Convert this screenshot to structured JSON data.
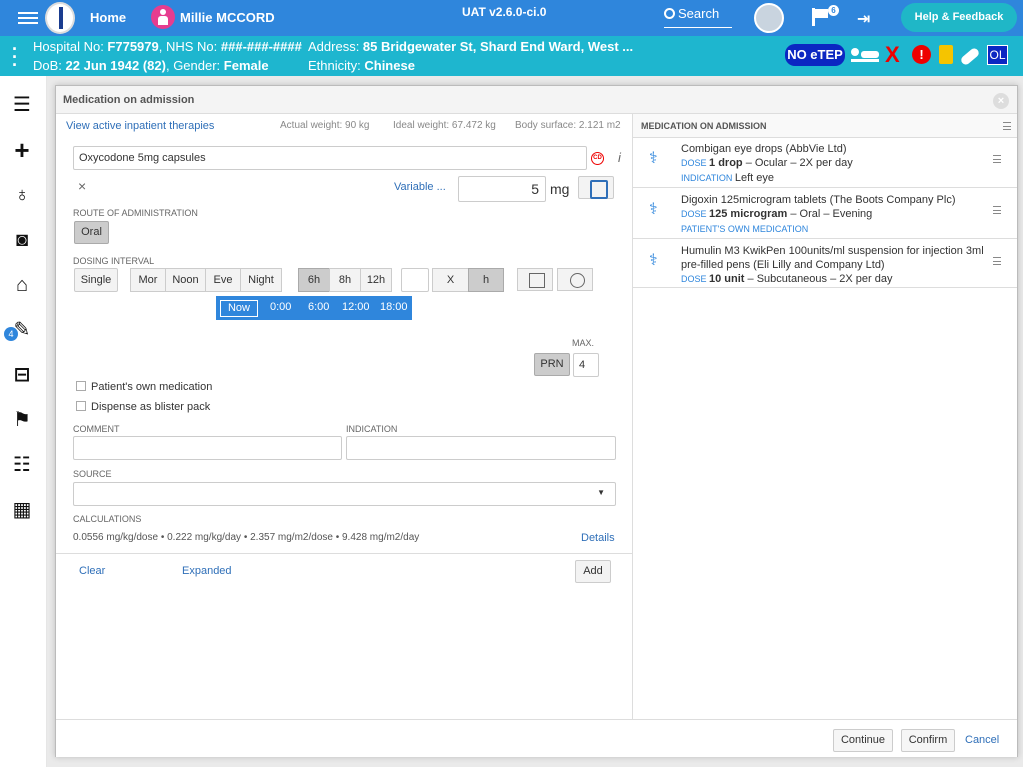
{
  "header": {
    "home_label": "Home",
    "patient_name": "Millie MCCORD",
    "version": "UAT v2.6.0-ci.0",
    "search_label": "Search",
    "flag_count": "6",
    "help_label": "Help & Feedback"
  },
  "patient_bar": {
    "hospital_no_label": "Hospital No: ",
    "hospital_no": "F775979",
    "nhs_label": ", NHS No: ",
    "nhs_no": "###-###-####",
    "dob_label": "DoB: ",
    "dob": "22 Jun 1942 (82)",
    "gender_label": ", Gender: ",
    "gender": "Female",
    "address_label": "Address: ",
    "address": "85 Bridgewater St, Shard End Ward, West ...",
    "ethnicity_label": "Ethnicity: ",
    "ethnicity": "Chinese",
    "no_etep": "NO eTEP",
    "ol": "OL",
    "alert": "!"
  },
  "sidebar": {
    "badge": "4",
    "icons": [
      "list-icon",
      "plus-icon",
      "stethoscope-icon",
      "camera-icon",
      "home-plus-icon",
      "prescription-edit-icon",
      "inbox-icon",
      "walking-icon",
      "checklist-icon",
      "monitor-icon"
    ]
  },
  "modal": {
    "title": "Medication on admission",
    "view_active_link": "View active inpatient therapies",
    "actual_weight": "Actual weight: 90 kg",
    "ideal_weight": "Ideal weight: 67.472 kg",
    "body_surface": "Body surface: 2.121 m2",
    "drug_value": "Oxycodone 5mg capsules",
    "cd_badge": "CD",
    "variable_link": "Variable ...",
    "dose_value": "5",
    "dose_unit": "mg",
    "route_label": "ROUTE OF ADMINISTRATION",
    "route_option": "Oral",
    "dosing_label": "DOSING INTERVAL",
    "dosing_single": "Single",
    "dosing_times": [
      "Mor",
      "Noon",
      "Eve",
      "Night"
    ],
    "dosing_hours": [
      "6h",
      "8h",
      "12h"
    ],
    "x_label": "X",
    "h_label": "h",
    "timeline_now": "Now",
    "timeline_times": [
      "0:00",
      "6:00",
      "12:00",
      "18:00"
    ],
    "max_label": "MAX.",
    "prn_label": "PRN",
    "max_value": "4",
    "own_med_label": "Patient's own medication",
    "blister_label": "Dispense as blister pack",
    "comment_label": "COMMENT",
    "indication_label": "INDICATION",
    "source_label": "SOURCE",
    "calc_label": "CALCULATIONS",
    "calc_text": "0.0556 mg/kg/dose • 0.222 mg/kg/day • 2.357 mg/m2/dose • 9.428 mg/m2/day",
    "details_link": "Details",
    "clear_link": "Clear",
    "expanded_link": "Expanded",
    "add_button": "Add",
    "continue_button": "Continue",
    "confirm_button": "Confirm",
    "cancel_link": "Cancel"
  },
  "admission_list": {
    "title": "MEDICATION ON ADMISSION",
    "items": [
      {
        "name": "Combigan eye drops (AbbVie Ltd)",
        "dose_cap": "DOSE ",
        "dose": "1 drop",
        "dose_rest": " – Ocular – 2X per day",
        "ind_cap": "INDICATION ",
        "ind": "Left eye"
      },
      {
        "name": "Digoxin 125microgram tablets (The Boots Company Plc)",
        "dose_cap": "DOSE ",
        "dose": "125 microgram",
        "dose_rest": " – Oral – Evening",
        "extra_cap": "PATIENT'S OWN MEDICATION"
      },
      {
        "name": "Humulin M3 KwikPen 100units/ml suspension for injection 3ml pre-filled pens (Eli Lilly and Company Ltd)",
        "dose_cap": "DOSE ",
        "dose": "10 unit",
        "dose_rest": " – Subcutaneous – 2X per day"
      }
    ]
  }
}
